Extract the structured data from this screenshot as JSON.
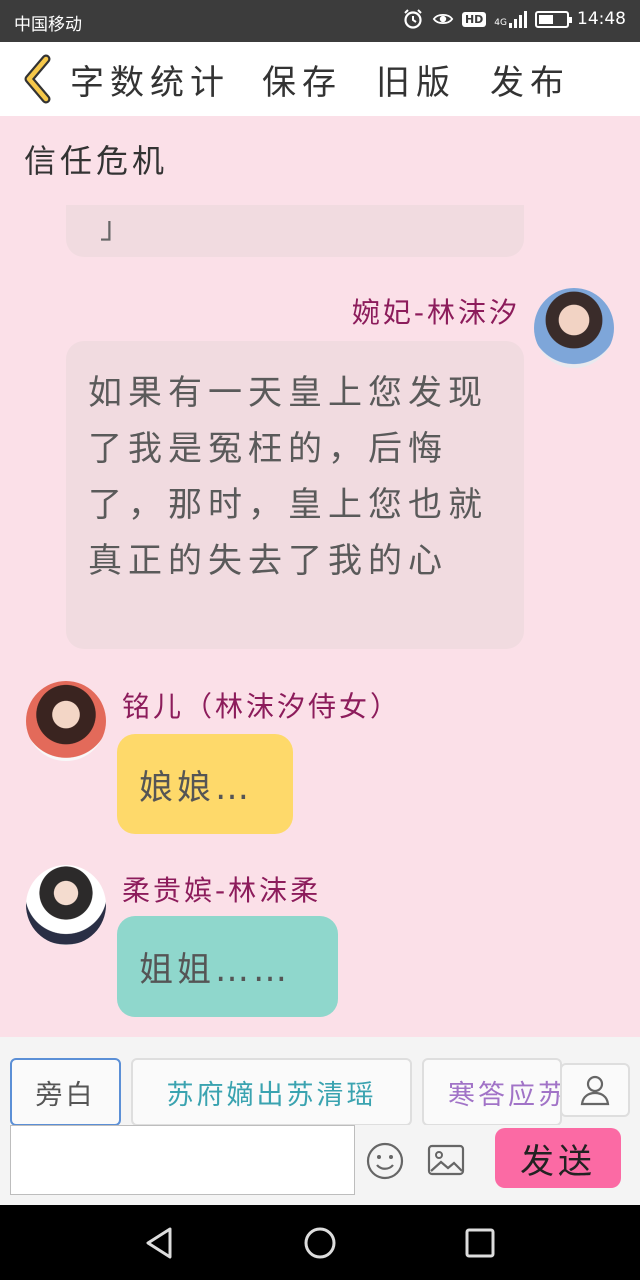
{
  "status_bar": {
    "carrier": "中国移动",
    "network": "4G",
    "hd": "HD",
    "time": "14:48",
    "icons": [
      "alarm-icon",
      "eye-icon",
      "hd-icon",
      "signal-icon",
      "battery-icon"
    ]
  },
  "toolbar": {
    "back_icon": "chevron-left-icon",
    "word_count": "字数统计",
    "save": "保存",
    "old_version": "旧版",
    "publish": "发布"
  },
  "story": {
    "title": "信任危机"
  },
  "messages": [
    {
      "side": "left-clipped",
      "text": "」"
    },
    {
      "side": "right",
      "name": "婉妃-林沫汐",
      "text": "如果有一天皇上您发现了我是冤枉的，后悔了，那时，皇上您也就真正的失去了我的心"
    },
    {
      "side": "left",
      "name": "铭儿（林沫汐侍女）",
      "text": "娘娘…",
      "color": "#fed96a"
    },
    {
      "side": "left",
      "name": "柔贵嫔-林沫柔",
      "text": "姐姐……",
      "color": "#8fd7cc"
    }
  ],
  "roles": {
    "narration": "旁白",
    "role1": "苏府嫡出苏清瑶",
    "role2": "寒答应苏",
    "user_icon": "person-icon"
  },
  "input": {
    "value": "",
    "emoji_icon": "emoji-icon",
    "image_icon": "image-icon",
    "send": "发送"
  },
  "colors": {
    "background": "#fbe0e8",
    "name_color": "#8c1c5b",
    "send_button": "#fb6aa4"
  }
}
